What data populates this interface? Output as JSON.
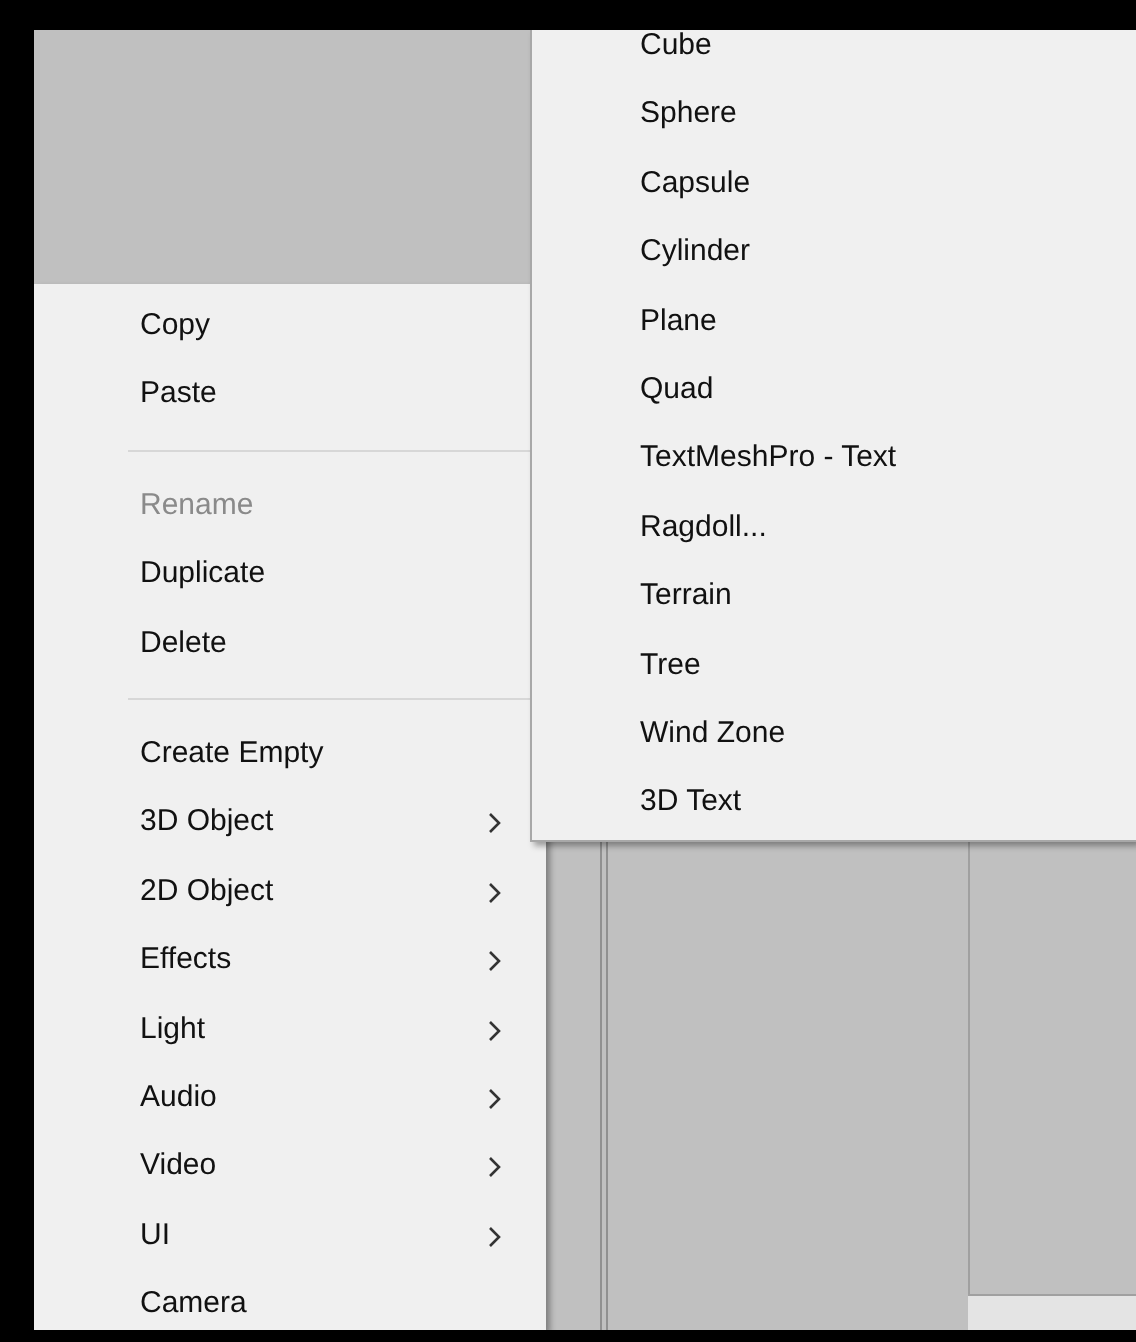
{
  "context_menu": {
    "items": [
      {
        "kind": "item",
        "label": "Copy",
        "disabled": false,
        "has_submenu": false
      },
      {
        "kind": "item",
        "label": "Paste",
        "disabled": false,
        "has_submenu": false
      },
      {
        "kind": "separator"
      },
      {
        "kind": "item",
        "label": "Rename",
        "disabled": true,
        "has_submenu": false
      },
      {
        "kind": "item",
        "label": "Duplicate",
        "disabled": false,
        "has_submenu": false
      },
      {
        "kind": "item",
        "label": "Delete",
        "disabled": false,
        "has_submenu": false
      },
      {
        "kind": "separator"
      },
      {
        "kind": "item",
        "label": "Create Empty",
        "disabled": false,
        "has_submenu": false
      },
      {
        "kind": "item",
        "label": "3D Object",
        "disabled": false,
        "has_submenu": true
      },
      {
        "kind": "item",
        "label": "2D Object",
        "disabled": false,
        "has_submenu": true
      },
      {
        "kind": "item",
        "label": "Effects",
        "disabled": false,
        "has_submenu": true
      },
      {
        "kind": "item",
        "label": "Light",
        "disabled": false,
        "has_submenu": true
      },
      {
        "kind": "item",
        "label": "Audio",
        "disabled": false,
        "has_submenu": true
      },
      {
        "kind": "item",
        "label": "Video",
        "disabled": false,
        "has_submenu": true
      },
      {
        "kind": "item",
        "label": "UI",
        "disabled": false,
        "has_submenu": true
      },
      {
        "kind": "item",
        "label": "Camera",
        "disabled": false,
        "has_submenu": false
      }
    ]
  },
  "submenu": {
    "items": [
      {
        "label": "Cube"
      },
      {
        "label": "Sphere"
      },
      {
        "label": "Capsule"
      },
      {
        "label": "Cylinder"
      },
      {
        "label": "Plane"
      },
      {
        "label": "Quad"
      },
      {
        "label": "TextMeshPro - Text"
      },
      {
        "label": "Ragdoll..."
      },
      {
        "label": "Terrain"
      },
      {
        "label": "Tree"
      },
      {
        "label": "Wind Zone"
      },
      {
        "label": "3D Text"
      }
    ]
  }
}
